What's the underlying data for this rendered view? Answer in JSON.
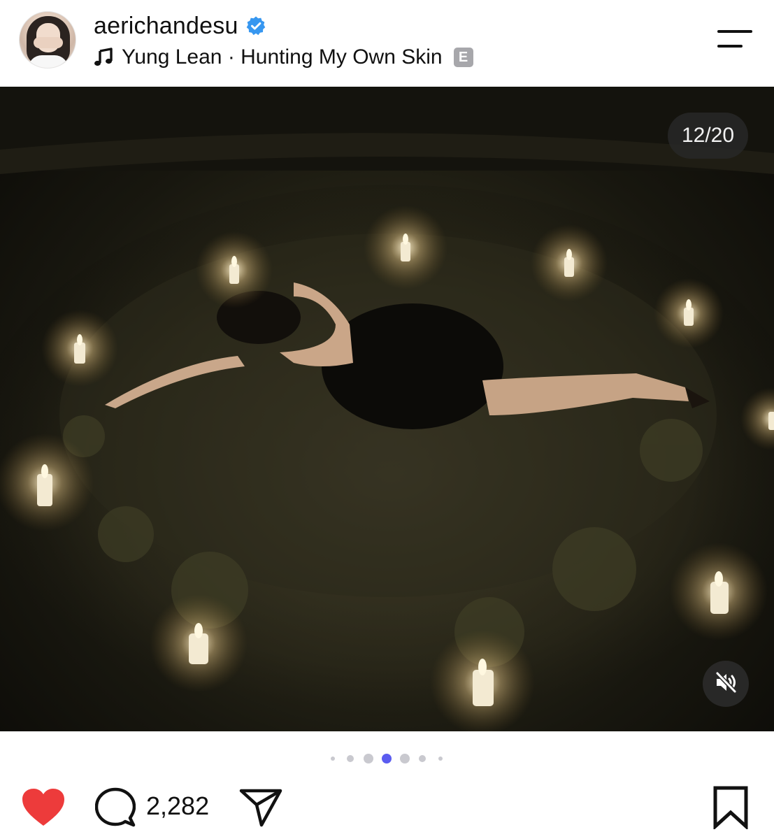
{
  "header": {
    "username": "aerichandesu",
    "verified": true,
    "music": {
      "text": "Yung Lean · Hunting My Own Skin",
      "explicit_label": "E"
    }
  },
  "photo": {
    "counter": "12/20",
    "audio_muted": true
  },
  "pager": {
    "total_visible_dots": 7,
    "active_index": 3
  },
  "actions": {
    "liked": true,
    "comment_count": "2,282"
  },
  "colors": {
    "like_red": "#ed3b3b",
    "verified_blue": "#3797f0",
    "active_dot": "#5b5cf0",
    "inactive_dot": "#c9c9cf"
  },
  "icons": [
    "verified-badge-icon",
    "music-note-icon",
    "menu-icon",
    "mute-icon",
    "heart-icon",
    "comment-icon",
    "share-icon",
    "bookmark-icon"
  ]
}
